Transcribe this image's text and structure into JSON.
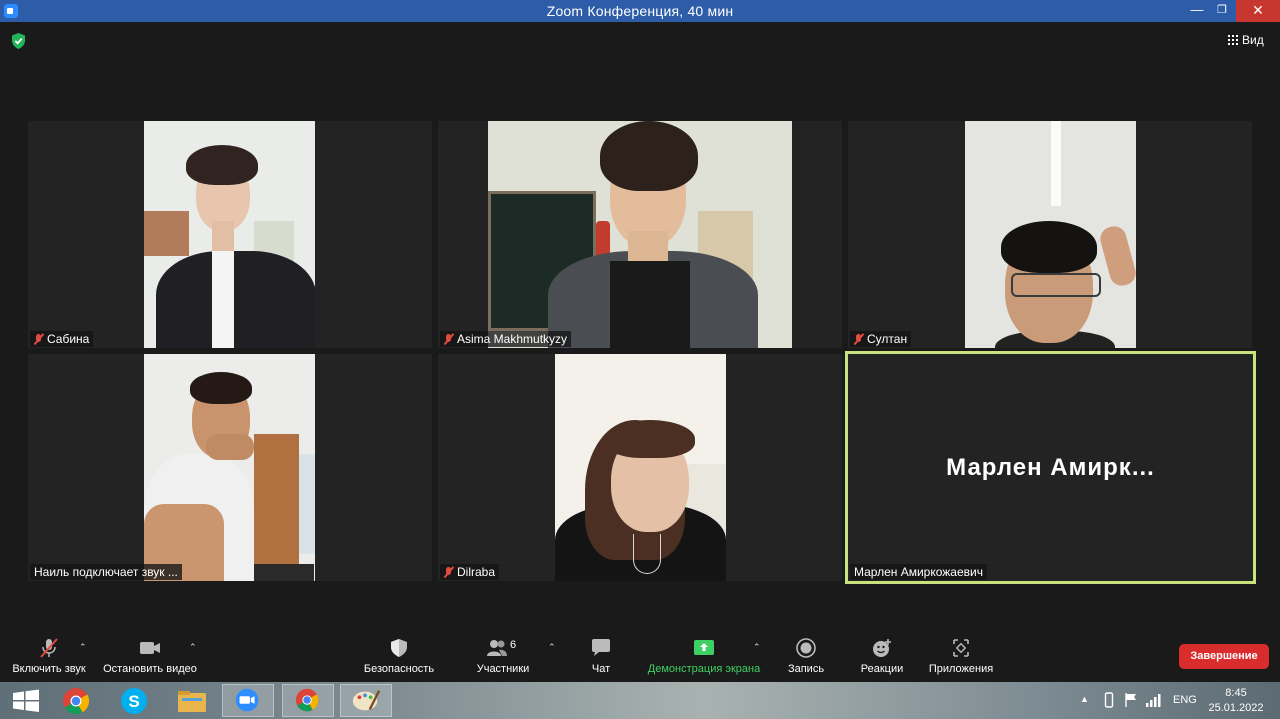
{
  "window": {
    "title": "Zoom Конференция, 40 мин"
  },
  "top": {
    "view_label": "Вид"
  },
  "participants": [
    {
      "name": "Сабина",
      "muted": true
    },
    {
      "name": "Asima Makhmutkyzy",
      "muted": true
    },
    {
      "name": "Султан",
      "muted": true
    },
    {
      "name": "Наиль подключает звук ...",
      "muted": false
    },
    {
      "name": "Dilraba",
      "muted": true
    },
    {
      "name": "Марлен Амиркожаевич",
      "muted": false,
      "display_name": "Марлен  Амирк...",
      "active_speaker": true
    }
  ],
  "toolbar": {
    "audio_label": "Включить звук",
    "video_label": "Остановить видео",
    "security_label": "Безопасность",
    "participants_label": "Участники",
    "participants_count": "6",
    "chat_label": "Чат",
    "share_label": "Демонстрация экрана",
    "record_label": "Запись",
    "reactions_label": "Реакции",
    "apps_label": "Приложения",
    "end_label": "Завершение"
  },
  "taskbar": {
    "apps": [
      "windows-start",
      "chrome",
      "skype",
      "file-explorer",
      "zoom",
      "chrome",
      "paint"
    ],
    "language": "ENG",
    "time": "8:45",
    "date": "25.01.2022"
  },
  "colors": {
    "speaker_border": "#c8e27d",
    "share_green": "#3ed063",
    "end_red": "#d92c2c",
    "titlebar": "#2d5da8"
  }
}
